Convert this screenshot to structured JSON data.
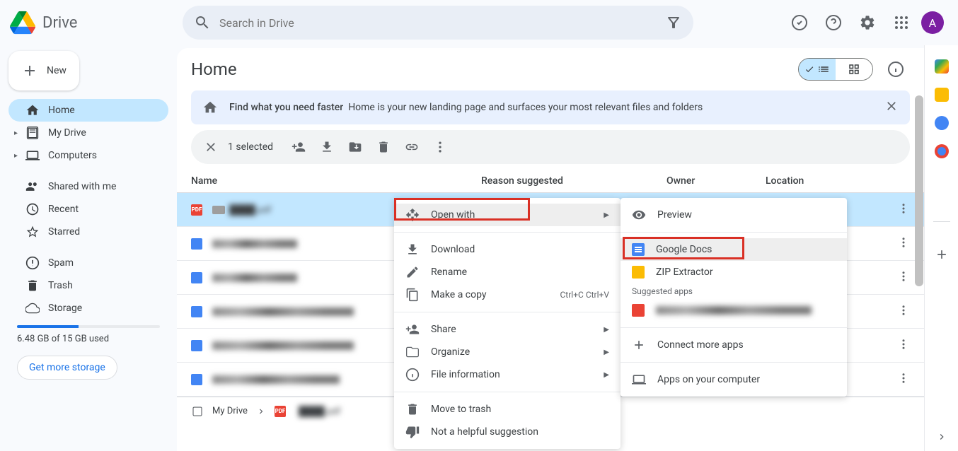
{
  "app": {
    "title": "Drive",
    "avatar_initial": "A"
  },
  "search": {
    "placeholder": "Search in Drive"
  },
  "sidebar": {
    "new_label": "New",
    "items": [
      {
        "label": "Home",
        "active": true
      },
      {
        "label": "My Drive"
      },
      {
        "label": "Computers"
      },
      {
        "label": "Shared with me"
      },
      {
        "label": "Recent"
      },
      {
        "label": "Starred"
      },
      {
        "label": "Spam"
      },
      {
        "label": "Trash"
      },
      {
        "label": "Storage"
      }
    ],
    "storage_used": "6.48 GB of 15 GB used",
    "storage_button": "Get more storage"
  },
  "main": {
    "title": "Home",
    "banner": {
      "title": "Find what you need faster",
      "text": "Home is your new landing page and surfaces your most relevant files and folders"
    },
    "selected_count": "1 selected",
    "columns": {
      "name": "Name",
      "reason": "Reason suggested",
      "owner": "Owner",
      "location": "Location"
    },
    "files": [
      {
        "name": "████.pdf",
        "type": "pdf",
        "selected": true
      },
      {
        "name": "████████",
        "type": "doc"
      },
      {
        "name": "████████",
        "type": "doc"
      },
      {
        "name": "████████████",
        "type": "doc"
      },
      {
        "name": "████████████",
        "type": "doc"
      },
      {
        "name": "████████████",
        "type": "doc"
      }
    ]
  },
  "breadcrumb": {
    "root": "My Drive",
    "file": "████.pdf"
  },
  "context_menu": {
    "open_with": "Open with",
    "download": "Download",
    "rename": "Rename",
    "copy": "Make a copy",
    "copy_shortcut": "Ctrl+C Ctrl+V",
    "share": "Share",
    "organize": "Organize",
    "file_info": "File information",
    "trash": "Move to trash",
    "not_helpful": "Not a helpful suggestion"
  },
  "submenu": {
    "preview": "Preview",
    "google_docs": "Google Docs",
    "zip_extractor": "ZIP Extractor",
    "suggested_header": "Suggested apps",
    "suggested_app": "████████████",
    "connect": "Connect more apps",
    "computer": "Apps on your computer"
  }
}
